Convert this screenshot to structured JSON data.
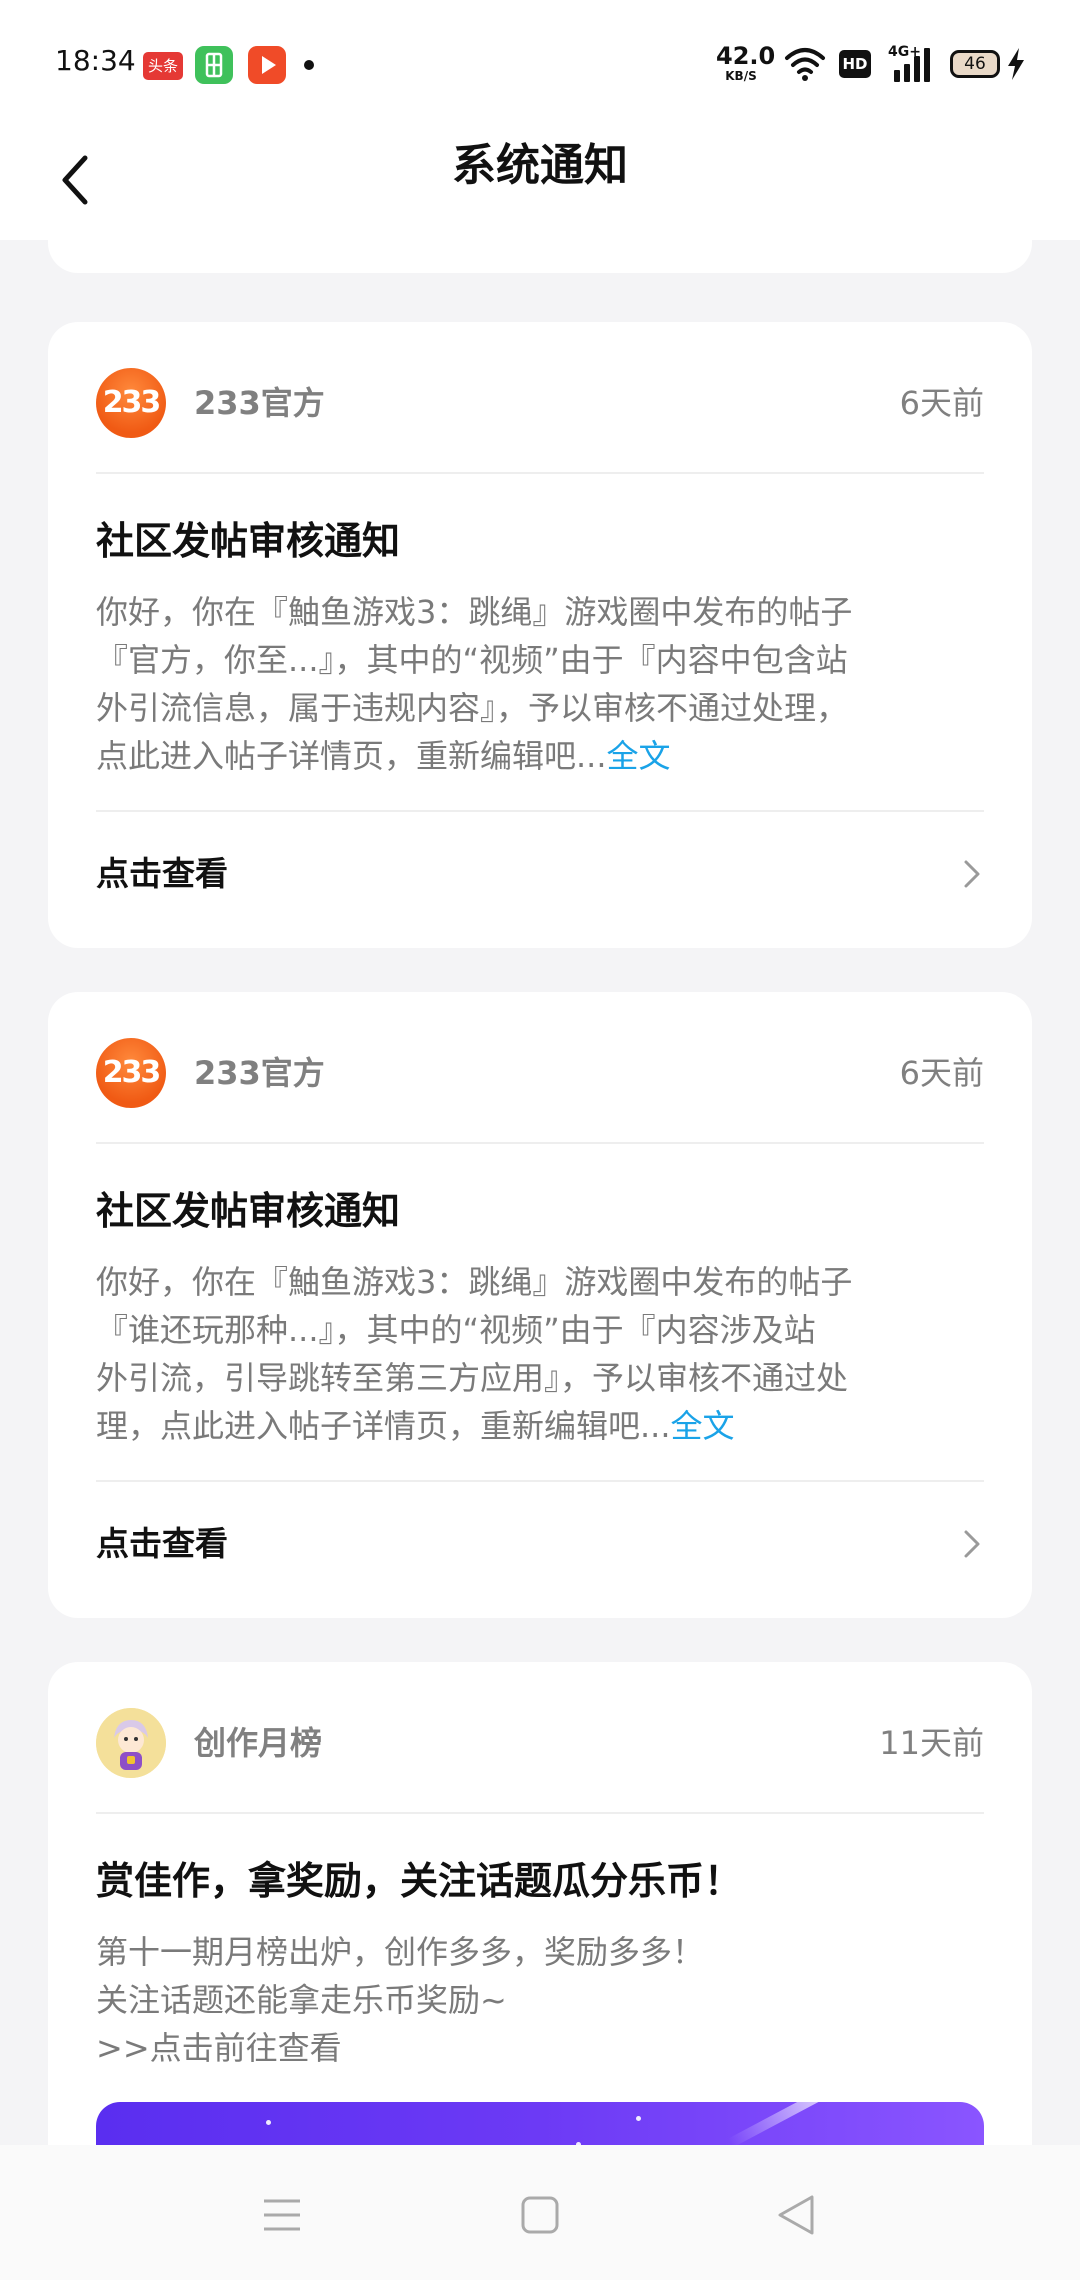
{
  "status_bar": {
    "time": "18:34",
    "toutiao_label": "头条",
    "net_speed_value": "42.0",
    "net_speed_unit": "KB/S",
    "hd_label": "HD",
    "network_type": "4G+",
    "battery_level": "46"
  },
  "nav": {
    "title": "系统通知"
  },
  "notifications": [
    {
      "sender": "233官方",
      "avatar_text": "233",
      "time": "6天前",
      "title": "社区发帖审核通知",
      "body": "你好，你在『鮋鱼游戏3：跳绳』游戏圈中发布的帖子\n『官方，你至...』，其中的“视频”由于『内容中包含站\n外引流信息，属于违规内容』，予以审核不通过处理，\n点此进入帖子详情页，重新编辑吧...",
      "full_text_link": "全文",
      "action": "点击查看"
    },
    {
      "sender": "233官方",
      "avatar_text": "233",
      "time": "6天前",
      "title": "社区发帖审核通知",
      "body": "你好，你在『鮋鱼游戏3：跳绳』游戏圈中发布的帖子\n『谁还玩那种...』，其中的“视频”由于『内容涉及站\n外引流，引导跳转至第三方应用』，予以审核不通过处\n理，点此进入帖子详情页，重新编辑吧...",
      "full_text_link": "全文",
      "action": "点击查看"
    },
    {
      "sender": "创作月榜",
      "time": "11天前",
      "title": "赏佳作，拿奖励，关注话题瓜分乐币！",
      "body": "第十一期月榜出炉，创作多多，奖励多多！\n关注话题还能拿走乐币奖励~\n>>点击前往查看"
    }
  ],
  "colors": {
    "accent_link": "#1aa3e8",
    "official_avatar": "#f05a14",
    "banner": "#5a2ef0"
  },
  "icons": {
    "back": "chevron-left-icon",
    "row_chevron": "chevron-right-icon",
    "sys_menu": "menu-icon",
    "sys_home": "square-icon",
    "sys_back": "triangle-back-icon"
  }
}
